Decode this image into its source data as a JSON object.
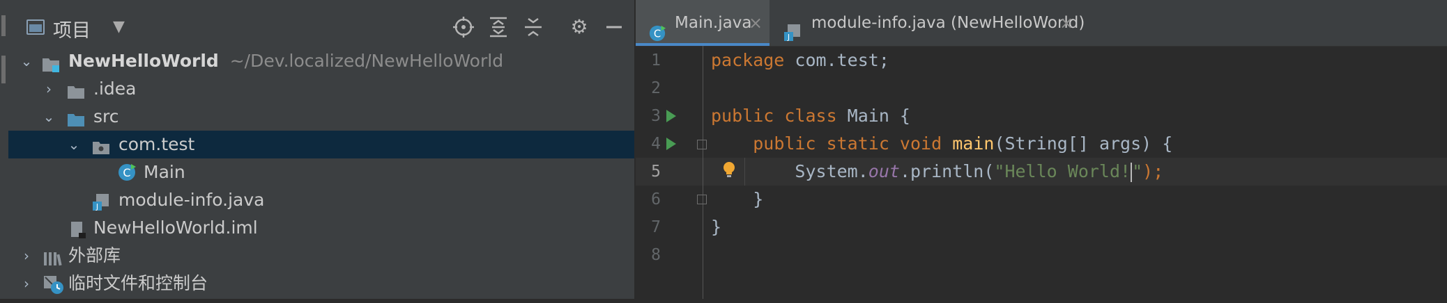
{
  "project_panel": {
    "title": "项目",
    "dropdown_icon": "triangle-down",
    "toolbar_icons": [
      "locate-icon",
      "expand-all-icon",
      "collapse-all-icon",
      "gear-icon",
      "hide-icon"
    ],
    "tree": [
      {
        "label": "NewHelloWorld",
        "sub": "~/Dev.localized/NewHelloWorld",
        "arrow": "⌄",
        "icon": "module-folder-icon"
      },
      {
        "label": ".idea",
        "arrow": "›",
        "icon": "folder-icon"
      },
      {
        "label": "src",
        "arrow": "⌄",
        "icon": "source-folder-icon"
      },
      {
        "label": "com.test",
        "arrow": "⌄",
        "icon": "package-icon"
      },
      {
        "label": "Main",
        "icon": "java-class-icon"
      },
      {
        "label": "module-info.java",
        "icon": "java-file-icon"
      },
      {
        "label": "NewHelloWorld.iml",
        "icon": "iml-file-icon"
      },
      {
        "label": "外部库",
        "arrow": "›",
        "icon": "library-icon"
      },
      {
        "label": "临时文件和控制台",
        "arrow": "›",
        "icon": "scratch-icon"
      }
    ]
  },
  "editor": {
    "tabs": [
      {
        "label": "Main.java",
        "close": "×",
        "active": true
      },
      {
        "label": "module-info.java (NewHelloWorld)",
        "close": "×",
        "active": false
      }
    ],
    "line_numbers": [
      "1",
      "2",
      "3",
      "4",
      "5",
      "6",
      "7",
      "8"
    ],
    "current_line": "5",
    "code": {
      "l1_kw": "package",
      "l1_rest": " com.test;",
      "l3_kw": "public class",
      "l3_rest": " Main {",
      "l4_kw": "public static void",
      "l4_fn": "main",
      "l4_rest": "(String[] args) {",
      "l5_pre": "System.",
      "l5_field": "out",
      "l5_mid": ".println(",
      "l5_str_a": "\"Hello World!",
      "l5_str_b": "\"",
      "l5_end": ");",
      "l6": "}",
      "l7": "}"
    }
  },
  "colors": {
    "background": "#2b2b2b",
    "panel": "#3c3f41",
    "selection": "#0d293e",
    "keyword": "#cc7832",
    "function": "#ffc66d",
    "string": "#6a8759",
    "field": "#9876aa",
    "run_marker": "#499c54"
  }
}
